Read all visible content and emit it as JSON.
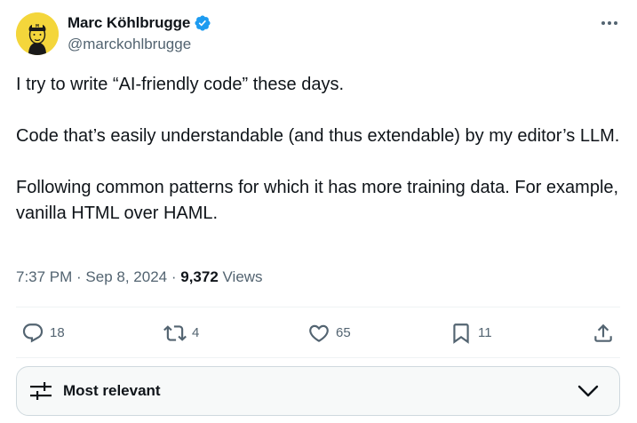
{
  "author": {
    "display_name": "Marc Köhlbrugge",
    "handle": "@marckohlbrugge",
    "avatar_icon": "avatar-illustration",
    "verified_icon": "verified-badge-icon"
  },
  "more_icon": "more-dots-icon",
  "tweet": {
    "paragraphs": [
      "I try to write “AI-friendly code” these days.",
      "Code that’s easily understandable (and thus extendable) by my editor’s LLM.",
      "Following common patterns for which it has more training data. For example, vanilla HTML over HAML."
    ]
  },
  "meta": {
    "time": "7:37 PM",
    "sep1": " · ",
    "date": "Sep 8, 2024",
    "sep2": " · ",
    "views_count": "9,372",
    "views_label": " Views"
  },
  "actions": {
    "replies": "18",
    "reposts": "4",
    "likes": "65",
    "bookmarks": "11"
  },
  "sort": {
    "label": "Most relevant"
  },
  "colors": {
    "text": "#0f1419",
    "secondary": "#536471",
    "verified": "#1d9bf0",
    "divider": "#eff3f4"
  }
}
